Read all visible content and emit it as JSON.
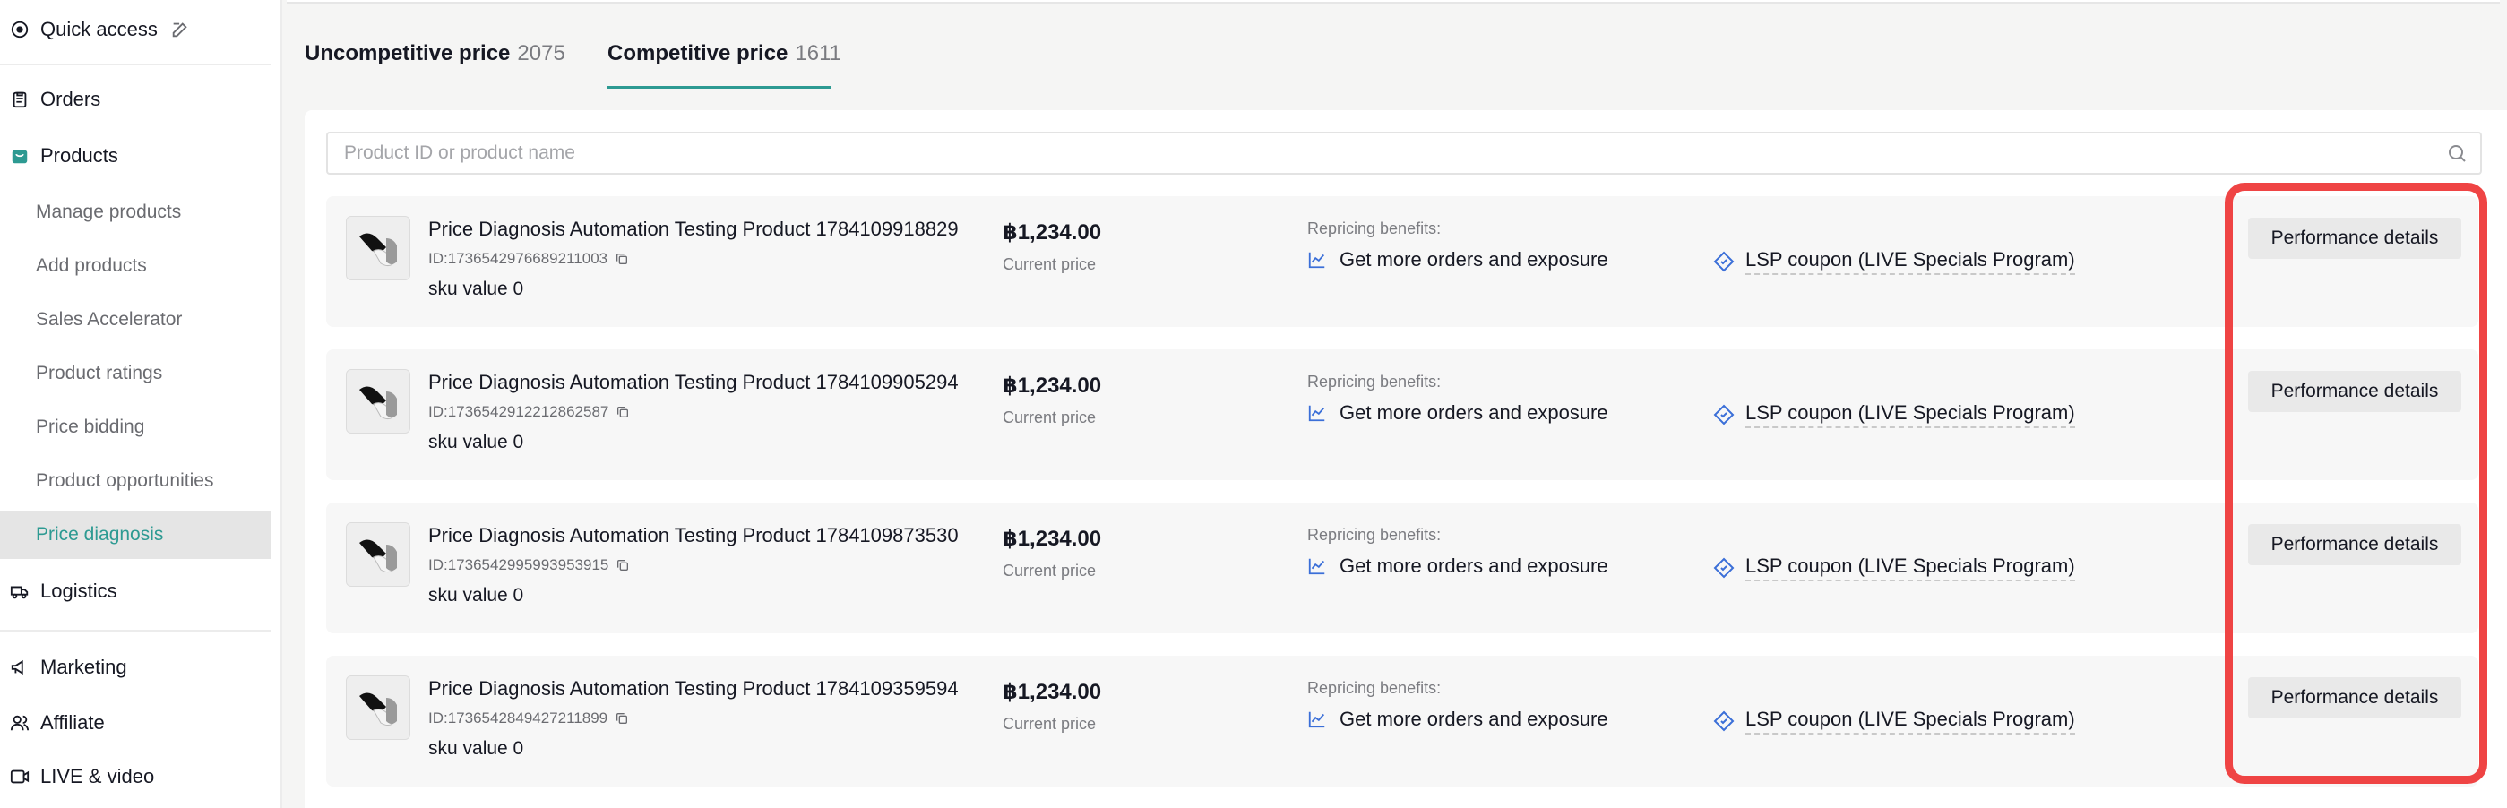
{
  "sidebar": {
    "quick_access": "Quick access",
    "orders": "Orders",
    "products": "Products",
    "sub_items": [
      {
        "label": "Manage products"
      },
      {
        "label": "Add products"
      },
      {
        "label": "Sales Accelerator"
      },
      {
        "label": "Product ratings"
      },
      {
        "label": "Price bidding"
      },
      {
        "label": "Product opportunities"
      },
      {
        "label": "Price diagnosis"
      }
    ],
    "logistics": "Logistics",
    "marketing": "Marketing",
    "affiliate": "Affiliate",
    "live_video": "LIVE & video",
    "accent_color": "#2d9a92"
  },
  "tabs": [
    {
      "label": "Uncompetitive price",
      "count": "2075",
      "active": false
    },
    {
      "label": "Competitive price",
      "count": "1611",
      "active": true
    }
  ],
  "search": {
    "placeholder": "Product ID or product name",
    "value": ""
  },
  "products": [
    {
      "name": "Price Diagnosis Automation Testing Product 1784109918829",
      "id": "ID:1736542976689211003",
      "sku": "sku value 0",
      "price": "฿1,234.00",
      "price_label": "Current price",
      "repricing_label": "Repricing benefits:",
      "benefit": "Get more orders and exposure",
      "coupon": "LSP coupon (LIVE Specials Program)",
      "button": "Performance details"
    },
    {
      "name": "Price Diagnosis Automation Testing Product 1784109905294",
      "id": "ID:1736542912212862587",
      "sku": "sku value 0",
      "price": "฿1,234.00",
      "price_label": "Current price",
      "repricing_label": "Repricing benefits:",
      "benefit": "Get more orders and exposure",
      "coupon": "LSP coupon (LIVE Specials Program)",
      "button": "Performance details"
    },
    {
      "name": "Price Diagnosis Automation Testing Product 1784109873530",
      "id": "ID:1736542995993953915",
      "sku": "sku value 0",
      "price": "฿1,234.00",
      "price_label": "Current price",
      "repricing_label": "Repricing benefits:",
      "benefit": "Get more orders and exposure",
      "coupon": "LSP coupon (LIVE Specials Program)",
      "button": "Performance details"
    },
    {
      "name": "Price Diagnosis Automation Testing Product 1784109359594",
      "id": "ID:1736542849427211899",
      "sku": "sku value 0",
      "price": "฿1,234.00",
      "price_label": "Current price",
      "repricing_label": "Repricing benefits:",
      "benefit": "Get more orders and exposure",
      "coupon": "LSP coupon (LIVE Specials Program)",
      "button": "Performance details"
    }
  ],
  "icons": {
    "quick_access": "target-icon",
    "edit": "edit-icon",
    "orders": "clipboard-icon",
    "products": "shopping-bag-icon",
    "logistics": "truck-icon",
    "marketing": "megaphone-icon",
    "affiliate": "people-icon",
    "live_video": "video-icon",
    "search": "search-icon",
    "copy": "copy-icon",
    "trend": "trend-up-icon",
    "coupon": "ticket-icon"
  },
  "highlight_color": "#ef4444"
}
